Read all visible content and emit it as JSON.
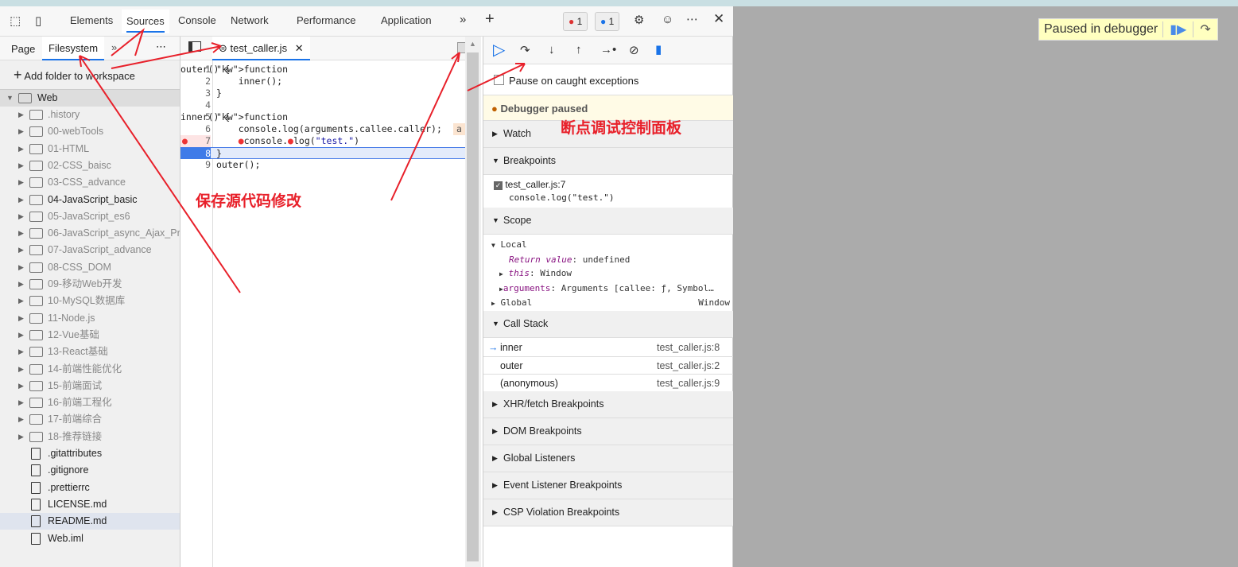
{
  "tabs": [
    "Elements",
    "Sources",
    "Console",
    "Network",
    "Performance",
    "Application"
  ],
  "active_tab": "Sources",
  "badges": {
    "errors": "1",
    "messages": "1"
  },
  "left": {
    "tabs": [
      "Page",
      "Filesystem"
    ],
    "add_folder": "Add folder to workspace",
    "root": "Web",
    "folders": [
      ".history",
      "00-webTools",
      "01-HTML",
      "02-CSS_baisc",
      "03-CSS_advance",
      "04-JavaScript_basic",
      "05-JavaScript_es6",
      "06-JavaScript_async_Ajax_Promise",
      "07-JavaScript_advance",
      "08-CSS_DOM",
      "09-移动Web开发",
      "10-MySQL数据库",
      "11-Node.js",
      "12-Vue基础",
      "13-React基础",
      "14-前端性能优化",
      "15-前端面试",
      "16-前端工程化",
      "17-前端综合",
      "18-推荐链接"
    ],
    "files": [
      ".gitattributes",
      ".gitignore",
      ".prettierrc",
      "LICENSE.md",
      "README.md",
      "Web.iml"
    ]
  },
  "editor": {
    "file": "test_caller.js",
    "lines": [
      "function outer() {",
      "    inner();",
      "}",
      "",
      "function inner() {",
      "    console.log(arguments.callee.caller);",
      "    console.log(\"test.\")",
      "}",
      "outer();"
    ],
    "inline_hint": "a",
    "breakpoint_line": "7",
    "current_line": "8"
  },
  "debugger": {
    "pause_caught": "Pause on caught exceptions",
    "paused": "Debugger paused",
    "sections": {
      "watch": "Watch",
      "breakpoints": "Breakpoints",
      "scope": "Scope",
      "callstack": "Call Stack",
      "xhr": "XHR/fetch Breakpoints",
      "dom": "DOM Breakpoints",
      "global": "Global Listeners",
      "event": "Event Listener Breakpoints",
      "csp": "CSP Violation Breakpoints"
    },
    "bp_file": "test_caller.js:7",
    "bp_code": "console.log(\"test.\")",
    "scope": {
      "local": "Local",
      "return_key": "Return value",
      "return_val": "undefined",
      "this_key": "this",
      "this_val": "Window",
      "args_key": "arguments",
      "args_val": "Arguments [callee: ƒ, Symbol…",
      "global": "Global",
      "global_val": "Window"
    },
    "stack": [
      {
        "fn": "inner",
        "loc": "test_caller.js:8"
      },
      {
        "fn": "outer",
        "loc": "test_caller.js:2"
      },
      {
        "fn": "(anonymous)",
        "loc": "test_caller.js:9"
      }
    ]
  },
  "overlay_banner": "Paused in debugger",
  "annotations": {
    "save": "保存源代码修改",
    "panel": "断点调试控制面板"
  },
  "colors": {
    "accent": "#1a73e8",
    "annotation": "#e8202a",
    "paused_bg": "#fffbe6"
  }
}
